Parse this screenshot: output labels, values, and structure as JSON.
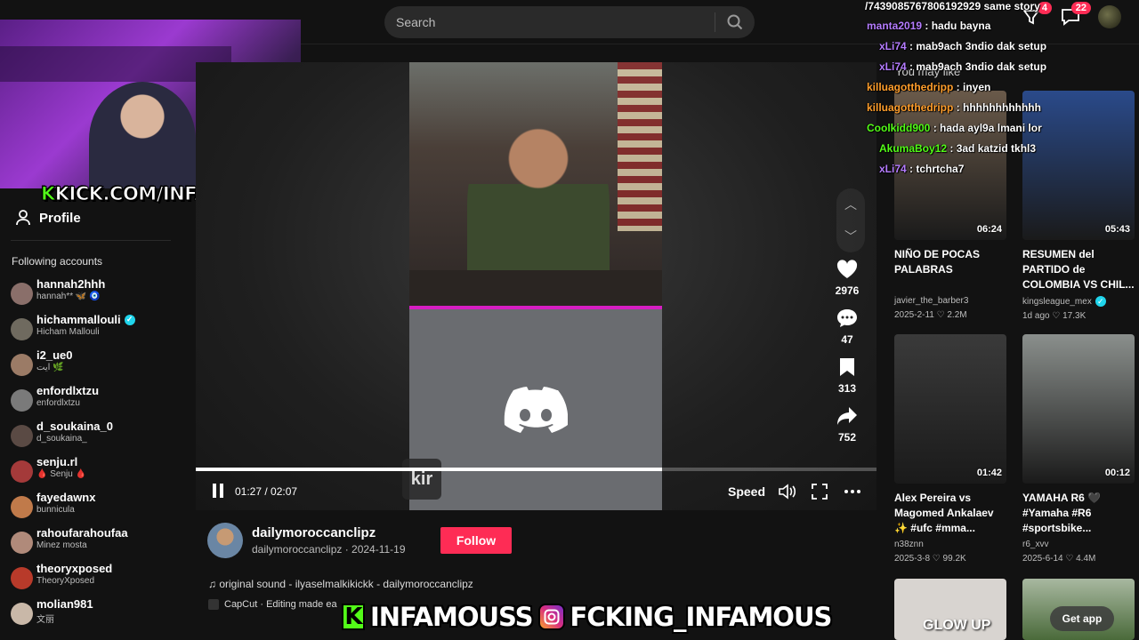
{
  "search": {
    "placeholder": "Search"
  },
  "header": {
    "upload_label": "Upload",
    "inbox_badge": "4",
    "messages_badge": "22"
  },
  "webcam": {
    "overlay_text": "KICK.COM/INFAMOUSS"
  },
  "sidebar": {
    "profile_label": "Profile",
    "following_heading": "Following accounts",
    "accounts": [
      {
        "name": "hannah2hhh",
        "sub": "hannah** 🦋 🧿",
        "verified": false,
        "color": "#8a6f6a"
      },
      {
        "name": "hichammallouli",
        "sub": "Hicham Mallouli",
        "verified": true,
        "color": "#6f6a5f"
      },
      {
        "name": "i2_ue0",
        "sub": "ايت 🌿",
        "verified": false,
        "color": "#9b7b66"
      },
      {
        "name": "enfordlxtzu",
        "sub": "enfordlxtzu",
        "verified": false,
        "color": "#7a7a7a"
      },
      {
        "name": "d_soukaina_0",
        "sub": "d_soukaina_",
        "verified": false,
        "color": "#5a4a44"
      },
      {
        "name": "senju.rl",
        "sub": "🩸 Senju 🩸",
        "verified": false,
        "color": "#a43a3a"
      },
      {
        "name": "fayedawnx",
        "sub": "bunnicula",
        "verified": false,
        "color": "#c07a4a"
      },
      {
        "name": "rahoufarahoufaa",
        "sub": "Minez mosta",
        "verified": false,
        "color": "#b08a7a"
      },
      {
        "name": "theoryxposed",
        "sub": "TheoryXposed",
        "verified": false,
        "color": "#b83a2a"
      },
      {
        "name": "molian981",
        "sub": "文丽",
        "verified": false,
        "color": "#c9b8a8"
      }
    ]
  },
  "player": {
    "overlay_word": "kir",
    "time": "01:27 / 02:07",
    "progress": 0.685,
    "speed_label": "Speed",
    "likes": "2976",
    "comments": "47",
    "saves": "313",
    "shares": "752"
  },
  "post": {
    "creator_name": "dailymoroccanclipz",
    "creator_sub": "dailymoroccanclipz · 2024-11-19",
    "follow_label": "Follow",
    "sound": "original sound - ilyaselmalkikickk - dailymoroccanclipz",
    "capcut": "CapCut · Editing made ea"
  },
  "chat": [
    {
      "user": "/743908576780619292",
      "text": "9 same story",
      "color": "#ffffff"
    },
    {
      "user": "manta2019",
      "text": " : hadu bayna",
      "color": "#b57cff"
    },
    {
      "user": "xLi74",
      "text": " : mab9ach 3ndio dak setup",
      "color": "#b57cff"
    },
    {
      "user": "xLi74",
      "text": " : mab9ach 3ndio dak setup",
      "color": "#b57cff"
    },
    {
      "user": "killuagotthedripp",
      "text": " : inyen",
      "color": "#ff9e2c"
    },
    {
      "user": "killuagotthedripp",
      "text": " : hhhhhhhhhhhh",
      "color": "#ff9e2c"
    },
    {
      "user": "Coolkidd900",
      "text": " : hada ayl9a lmani lor",
      "color": "#53fc18"
    },
    {
      "user": "AkumaBoy12",
      "text": " : 3ad katzid tkhl3",
      "color": "#53fc18"
    },
    {
      "user": "xLi74",
      "text": " : tchrtcha7",
      "color": "#b57cff"
    }
  ],
  "recs": {
    "title": "You may like",
    "items": [
      {
        "title": "NIÑO DE POCAS PALABRAS",
        "author": "javier_the_barber3",
        "verified": false,
        "meta": "2025-2-11 ♡ 2.2M",
        "duration": "06:24",
        "bg": "#6a5a4a"
      },
      {
        "title": "RESUMEN del PARTIDO de COLOMBIA VS CHIL...",
        "author": "kingsleague_mex",
        "verified": true,
        "meta": "1d ago ♡ 17.3K",
        "duration": "05:43",
        "bg": "#2a4a8a"
      },
      {
        "title": "Alex Pereira vs Magomed Ankalaev ✨ #ufc #mma...",
        "author": "n38znn",
        "verified": false,
        "meta": "2025-3-8 ♡ 99.2K",
        "duration": "01:42",
        "bg": "#3a3a3a"
      },
      {
        "title": "YAMAHA R6 🖤 #Yamaha #R6 #sportsbike...",
        "author": "r6_xvv",
        "verified": false,
        "meta": "2025-6-14 ♡ 4.4M",
        "duration": "00:12",
        "bg": "#8a8f8c"
      }
    ],
    "bottom_thumb_label": "GLOW UP",
    "get_app": "Get app"
  },
  "banner": {
    "kick_text": "INFAMOUSS",
    "ig_text": "FCKING_INFAMOUS"
  }
}
